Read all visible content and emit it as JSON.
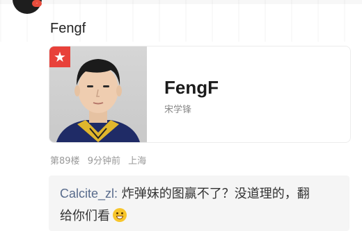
{
  "post": {
    "text": "Fengf"
  },
  "card": {
    "badge_icon": "star-icon",
    "name": "FengF",
    "real_name": "宋学锋"
  },
  "meta": {
    "floor": "第89楼",
    "time": "9分钟前",
    "location": "上海"
  },
  "quote": {
    "user": "Calcite_zl:",
    "line1": "炸弹妹的图赢不了？没道理的，翻",
    "line2": "给你们看",
    "emoji_icon": "grinning-emoji-icon"
  },
  "colors": {
    "badge_red": "#e8413a",
    "username_blue": "#586b8c",
    "meta_gray": "#999999"
  }
}
